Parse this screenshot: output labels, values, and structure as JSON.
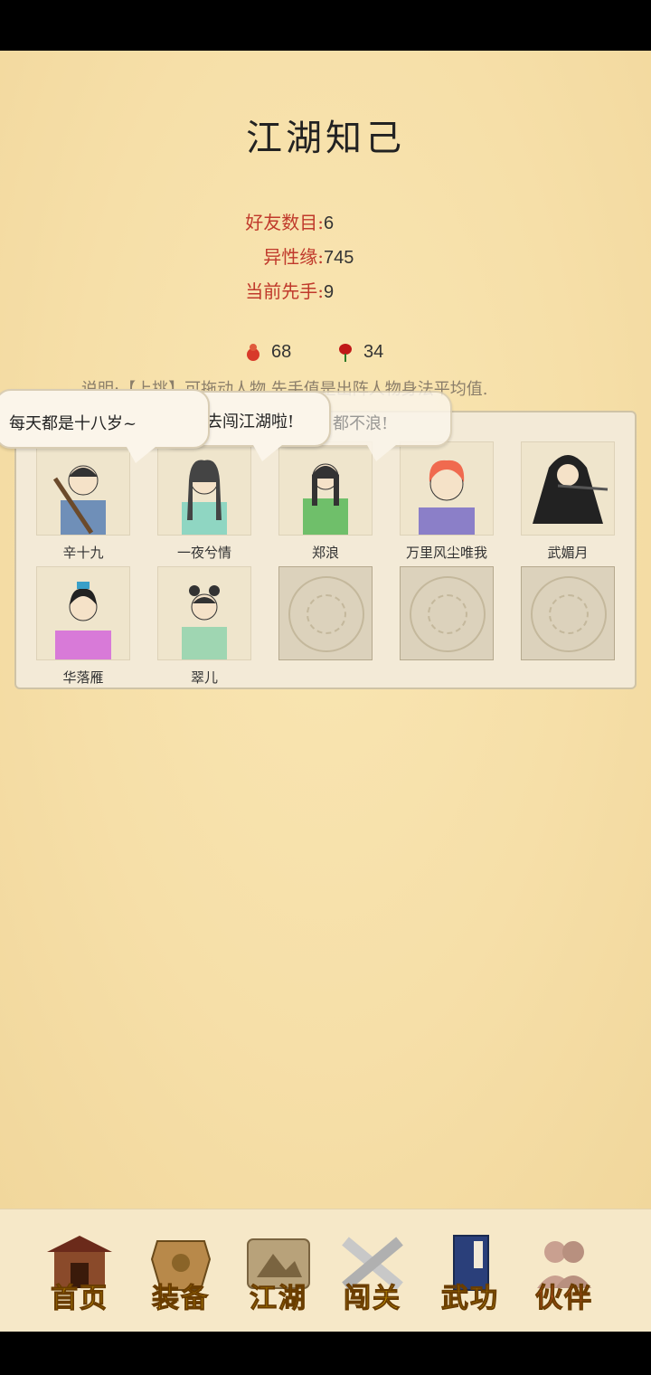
{
  "title": "江湖知己",
  "stats": [
    {
      "label": "好友数目:",
      "value": "6"
    },
    {
      "label": "异性缘:",
      "value": "745"
    },
    {
      "label": "当前先手:",
      "value": "9"
    }
  ],
  "currency": {
    "gourd": "68",
    "rose": "34"
  },
  "description": "说明:【上挑】可拖动人物,先手值是出阵人物身法平均值.",
  "bubbles": [
    "每天都是十八岁~",
    "去闯江湖啦!",
    "都不浪!"
  ],
  "companions": [
    "辛十九",
    "一夜兮情",
    "郑浪",
    "万里风尘唯我",
    "武媚月",
    "华落雁",
    "翠儿"
  ],
  "empty_slots": 3,
  "nav": [
    {
      "label": "首页",
      "icon": "house-icon"
    },
    {
      "label": "装备",
      "icon": "armor-icon"
    },
    {
      "label": "江湖",
      "icon": "scroll-map-icon"
    },
    {
      "label": "闯关",
      "icon": "crossed-swords-icon"
    },
    {
      "label": "武功",
      "icon": "book-icon"
    },
    {
      "label": "伙伴",
      "icon": "companions-icon",
      "active": true
    }
  ],
  "colors": {
    "accent_red": "#c0392b",
    "nav_gold": "#e6b400",
    "nav_active": "#ff5a3c"
  }
}
